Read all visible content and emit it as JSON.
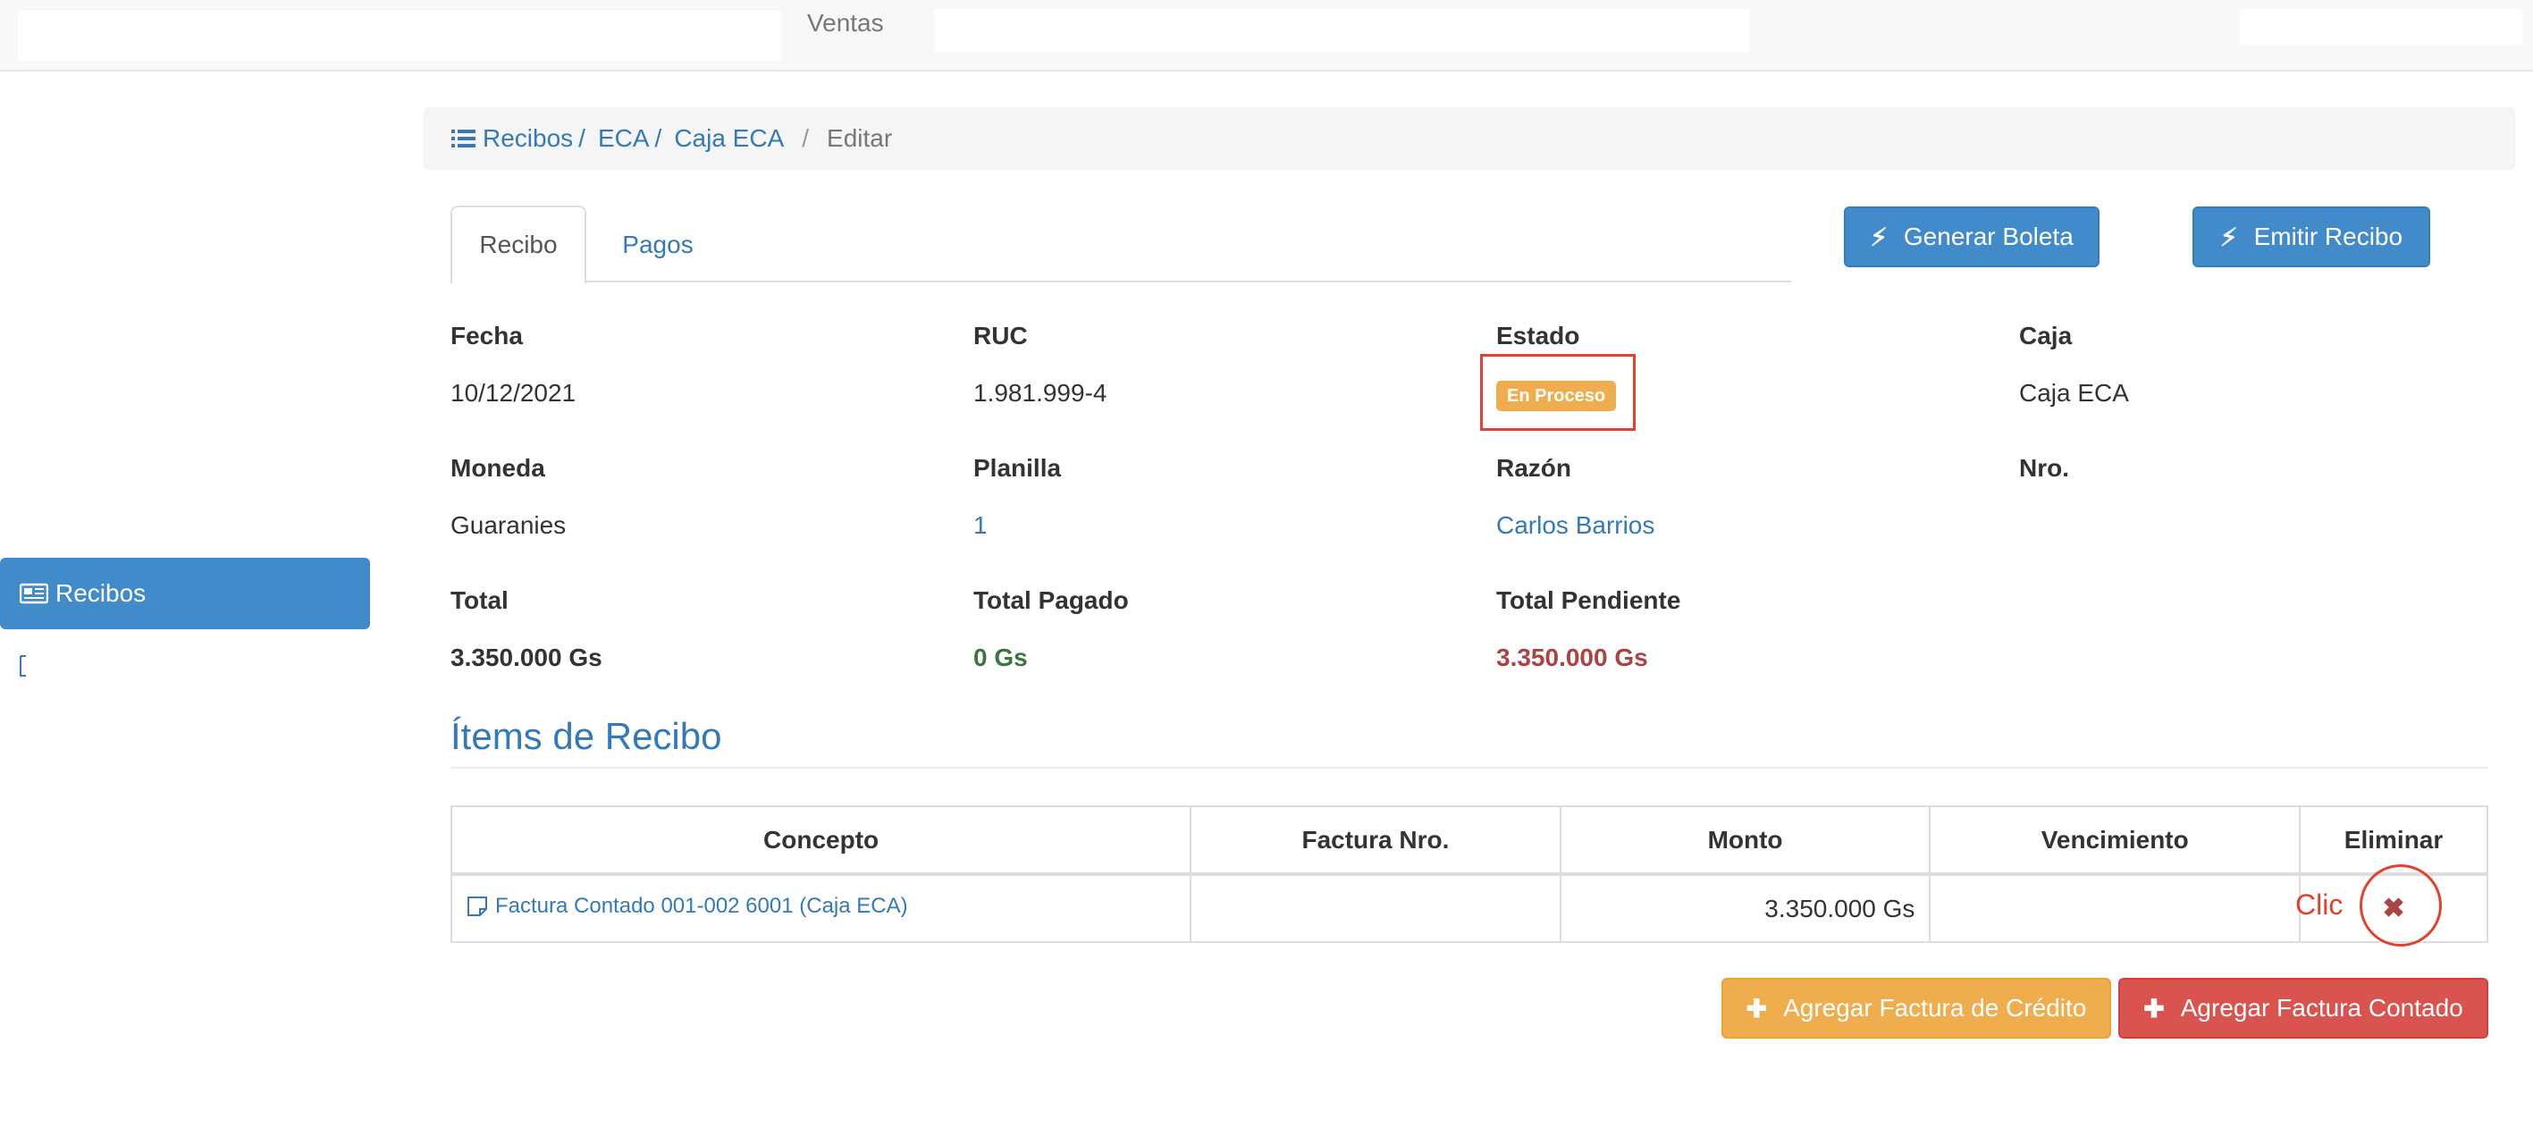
{
  "navbar": {
    "title": "Ventas"
  },
  "sidebar": {
    "active_item": "Recibos"
  },
  "breadcrumb": {
    "items": [
      "Recibos",
      "ECA",
      "Caja ECA"
    ],
    "current": "Editar"
  },
  "tabs": [
    "Recibo",
    "Pagos"
  ],
  "actions": {
    "generar_boleta": "Generar Boleta",
    "emitir_recibo": "Emitir Recibo"
  },
  "fields": {
    "fecha": {
      "label": "Fecha",
      "value": "10/12/2021"
    },
    "ruc": {
      "label": "RUC",
      "value": "1.981.999-4"
    },
    "estado": {
      "label": "Estado",
      "value": "En Proceso"
    },
    "caja": {
      "label": "Caja",
      "value": "Caja ECA"
    },
    "moneda": {
      "label": "Moneda",
      "value": "Guaranies"
    },
    "planilla": {
      "label": "Planilla",
      "value": "1"
    },
    "razon": {
      "label": "Razón",
      "value": "Carlos Barrios"
    },
    "nro": {
      "label": "Nro."
    },
    "total": {
      "label": "Total",
      "value": "3.350.000 Gs"
    },
    "total_pagado": {
      "label": "Total Pagado",
      "value": "0 Gs"
    },
    "total_pendiente": {
      "label": "Total Pendiente",
      "value": "3.350.000 Gs"
    }
  },
  "items_section": {
    "title": "Ítems de Recibo",
    "columns": [
      "Concepto",
      "Factura Nro.",
      "Monto",
      "Vencimiento",
      "Eliminar"
    ],
    "rows": [
      {
        "concepto": "Factura Contado 001-002 6001 (Caja ECA)",
        "factura_nro": "",
        "monto": "3.350.000 Gs",
        "vencimiento": ""
      }
    ]
  },
  "bottom_actions": {
    "agregar_credito": "Agregar Factura de Crédito",
    "agregar_contado": "Agregar Factura Contado"
  },
  "annotation": {
    "text": "Clic",
    "color": "#e2412e"
  },
  "colors": {
    "primary": "#428bca",
    "warning": "#f0ad4e",
    "danger": "#d9534f",
    "link": "#337ab7"
  }
}
